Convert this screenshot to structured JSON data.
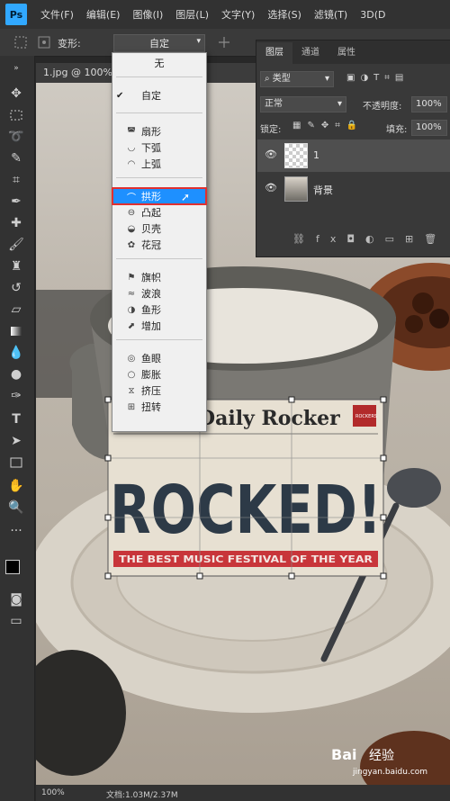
{
  "app": {
    "logo": "Ps"
  },
  "menubar": {
    "items": [
      "文件(F)",
      "编辑(E)",
      "图像(I)",
      "图层(L)",
      "文字(Y)",
      "选择(S)",
      "滤镜(T)",
      "3D(D"
    ]
  },
  "options": {
    "warp_label": "变形:",
    "warp_value": "自定"
  },
  "document": {
    "tab_title": "1.jpg @ 100% ("
  },
  "warp_menu": {
    "none": "无",
    "custom": "自定",
    "items": [
      {
        "label": "扇形",
        "icon": "arc-icon"
      },
      {
        "label": "下弧",
        "icon": "arc-lower-icon"
      },
      {
        "label": "上弧",
        "icon": "arc-upper-icon"
      },
      {
        "label": "拱形",
        "icon": "arch-icon"
      },
      {
        "label": "凸起",
        "icon": "bulge-icon"
      },
      {
        "label": "贝壳",
        "icon": "shell-icon"
      },
      {
        "label": "花冠",
        "icon": "flower-icon"
      },
      {
        "label": "旗帜",
        "icon": "flag-icon"
      },
      {
        "label": "波浪",
        "icon": "wave-icon"
      },
      {
        "label": "鱼形",
        "icon": "fish-icon"
      },
      {
        "label": "增加",
        "icon": "rise-icon"
      },
      {
        "label": "鱼眼",
        "icon": "fisheye-icon"
      },
      {
        "label": "膨胀",
        "icon": "inflate-icon"
      },
      {
        "label": "挤压",
        "icon": "squeeze-icon"
      },
      {
        "label": "扭转",
        "icon": "twist-icon"
      }
    ],
    "highlighted": "拱形"
  },
  "layers_panel": {
    "tabs": [
      "图层",
      "通道",
      "属性"
    ],
    "filter_label": "类型",
    "blend_mode": "正常",
    "opacity_label": "不透明度:",
    "opacity_value": "100%",
    "lock_label": "锁定:",
    "fill_label": "填充:",
    "fill_value": "100%",
    "layers": [
      {
        "name": "1",
        "selected": true
      },
      {
        "name": "背景",
        "selected": false
      }
    ]
  },
  "artwork": {
    "masthead": "Daily Rocker",
    "headline": "ROCKED!",
    "banner": "THE BEST MUSIC FESTIVAL OF THE YEAR",
    "badge": "ROCKERS"
  },
  "status": {
    "zoom": "100%",
    "doc_info": "文档:1.03M/2.37M"
  },
  "watermark": {
    "brand": "Bai",
    "brand_suffix": "经验",
    "url": "jingyan.baidu.com"
  },
  "colors": {
    "accent": "#31a8ff",
    "highlight_border": "#e03030",
    "banner_red": "#c8353a"
  }
}
